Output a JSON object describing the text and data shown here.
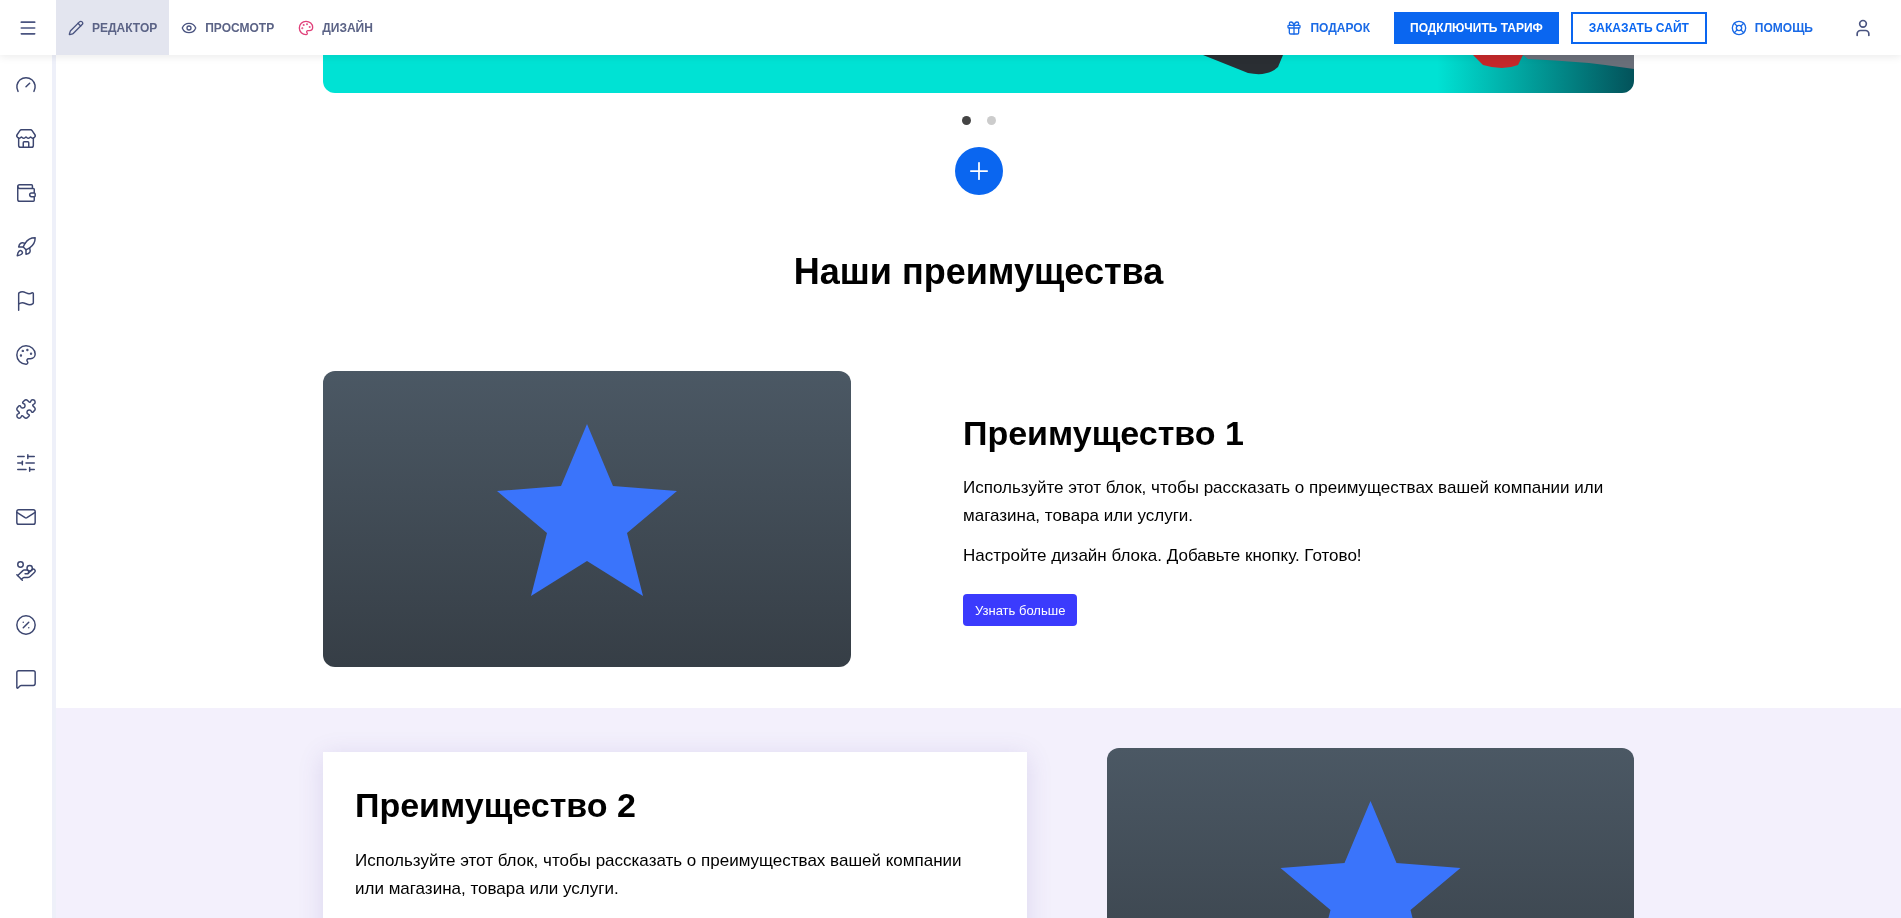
{
  "topbar": {
    "modes": [
      {
        "label": "РЕДАКТОР",
        "selected": true
      },
      {
        "label": "ПРОСМОТР",
        "selected": false
      },
      {
        "label": "ДИЗАЙН",
        "selected": false
      }
    ],
    "gift": "ПОДАРОК",
    "plan": "ПОДКЛЮЧИТЬ ТАРИФ",
    "order": "ЗАКАЗАТЬ САЙТ",
    "help": "ПОМОЩЬ"
  },
  "carousel": {
    "dots": [
      {
        "selected": true
      },
      {
        "selected": false
      }
    ]
  },
  "section": {
    "title": "Наши преимущества"
  },
  "features": [
    {
      "kind": "plain",
      "title": "Преимущество 1",
      "paragraphs": [
        "Используйте этот блок, чтобы рассказать о преимуществах вашей компании или магазина, товара или услуги.",
        "Настройте дизайн блока. Добавьте кнопку. Готово!"
      ],
      "button": "Узнать больше"
    },
    {
      "kind": "card",
      "title": "Преимущество 2",
      "paragraphs": [
        "Используйте этот блок, чтобы рассказать о преимуществах вашей компании или магазина, товара или услуги."
      ]
    }
  ]
}
